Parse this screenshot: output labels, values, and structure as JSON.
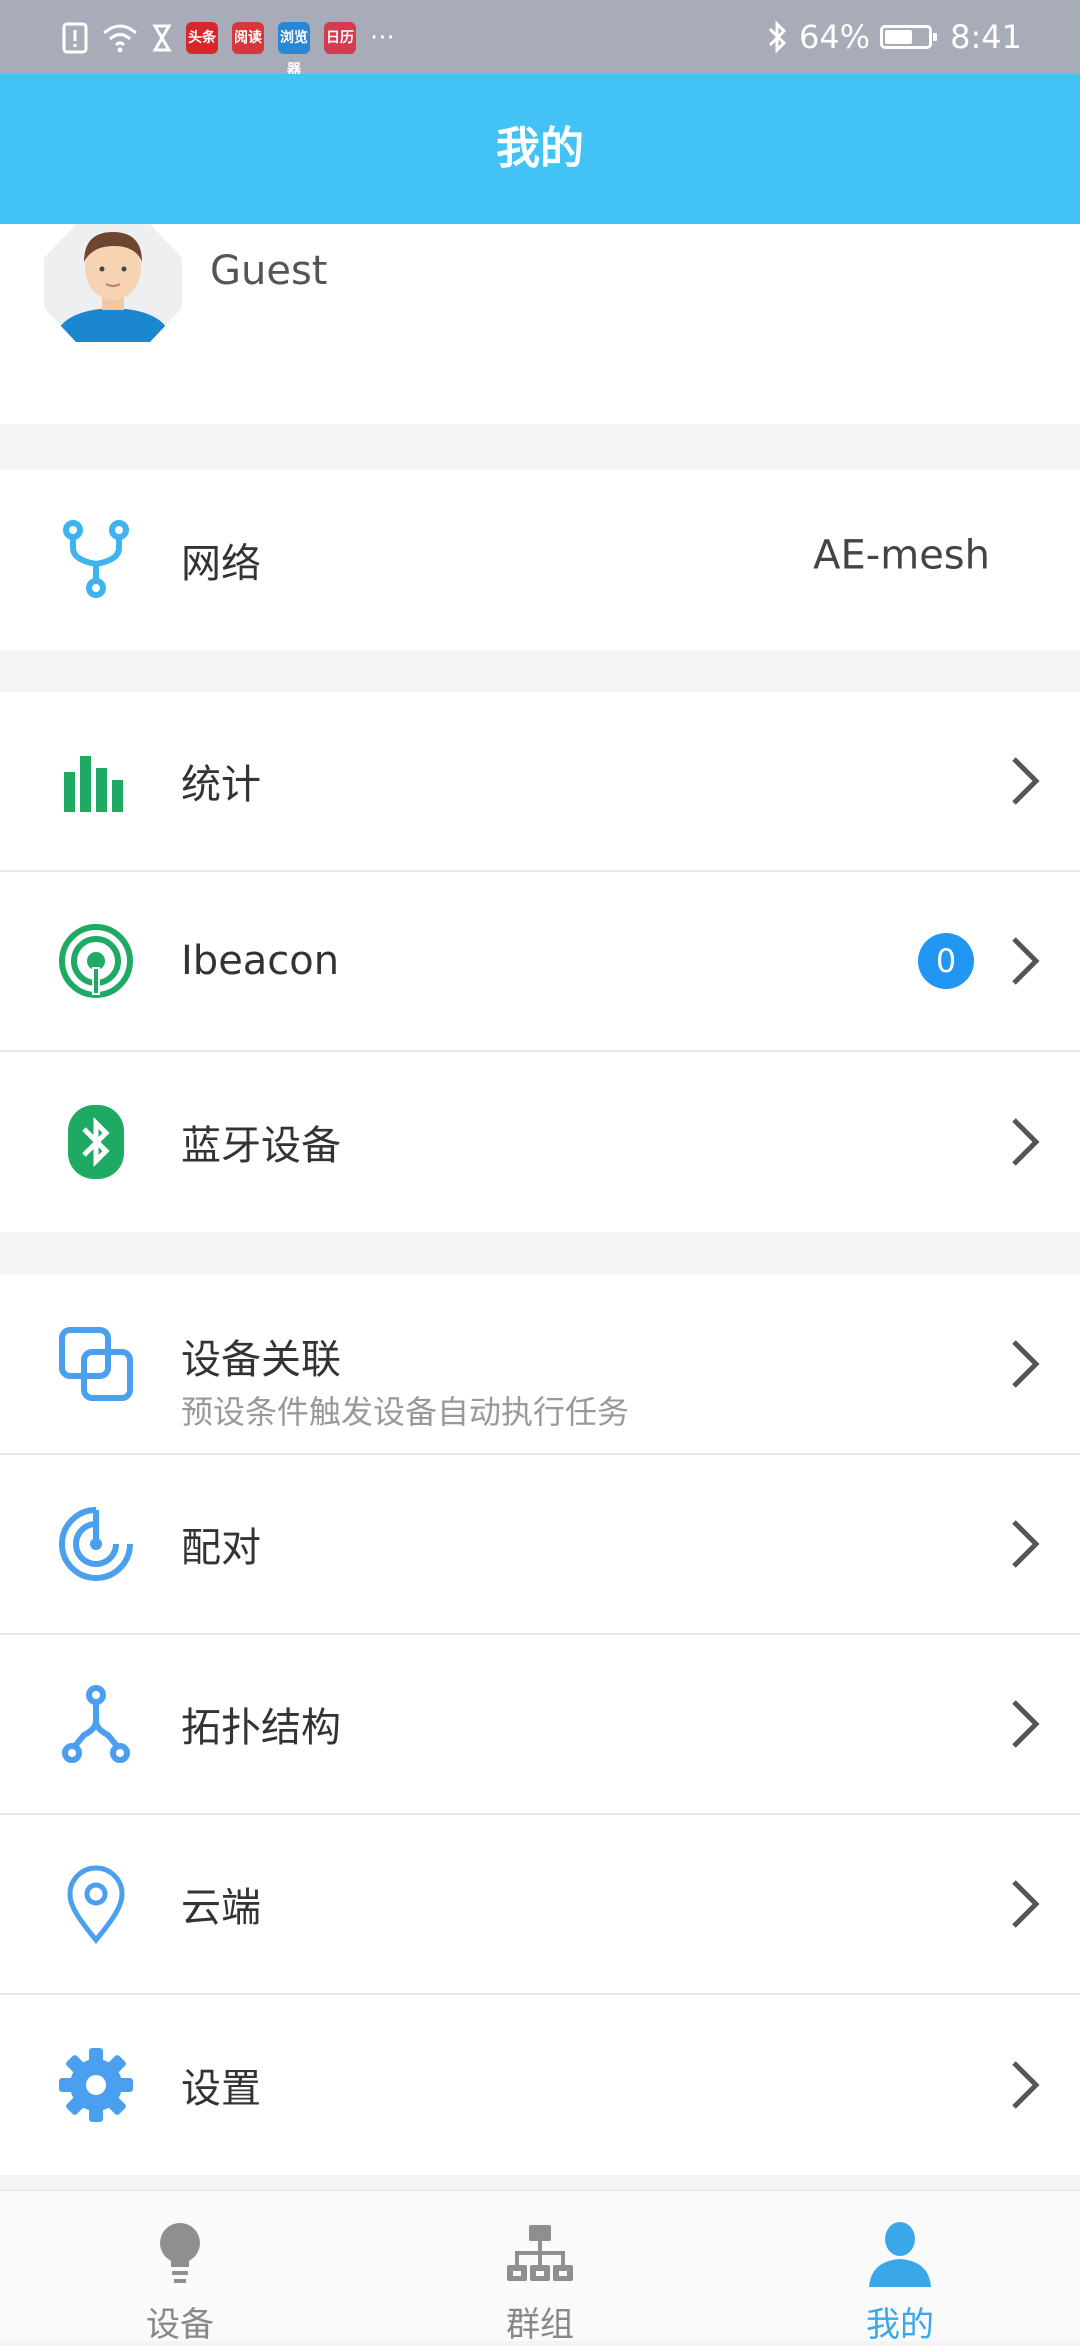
{
  "status_bar": {
    "battery_percent_text": "64%",
    "battery_level": 0.64,
    "time": "8:41",
    "app_icons": [
      "头条",
      "阅读",
      "浏览器",
      "日历"
    ],
    "more": "···"
  },
  "header": {
    "title": "我的"
  },
  "profile": {
    "name": "Guest"
  },
  "network": {
    "label": "网络",
    "value": "AE-mesh"
  },
  "menu_group1": [
    {
      "label": "统计"
    },
    {
      "label": "Ibeacon",
      "badge": "0"
    },
    {
      "label": "蓝牙设备"
    }
  ],
  "menu_group2": [
    {
      "label": "设备关联",
      "sub": "预设条件触发设备自动执行任务"
    },
    {
      "label": "配对"
    },
    {
      "label": "拓扑结构"
    },
    {
      "label": "云端"
    },
    {
      "label": "设置"
    }
  ],
  "bottom_nav": [
    {
      "label": "设备",
      "icon": "bulb-icon"
    },
    {
      "label": "群组",
      "icon": "hierarchy-icon"
    },
    {
      "label": "我的",
      "icon": "person-icon",
      "active": true
    }
  ],
  "colors": {
    "header": "#42c2f5",
    "accent": "#3aa8e8",
    "green": "#1faa63",
    "blue_icon": "#4a9fef",
    "badge": "#2196f3"
  }
}
